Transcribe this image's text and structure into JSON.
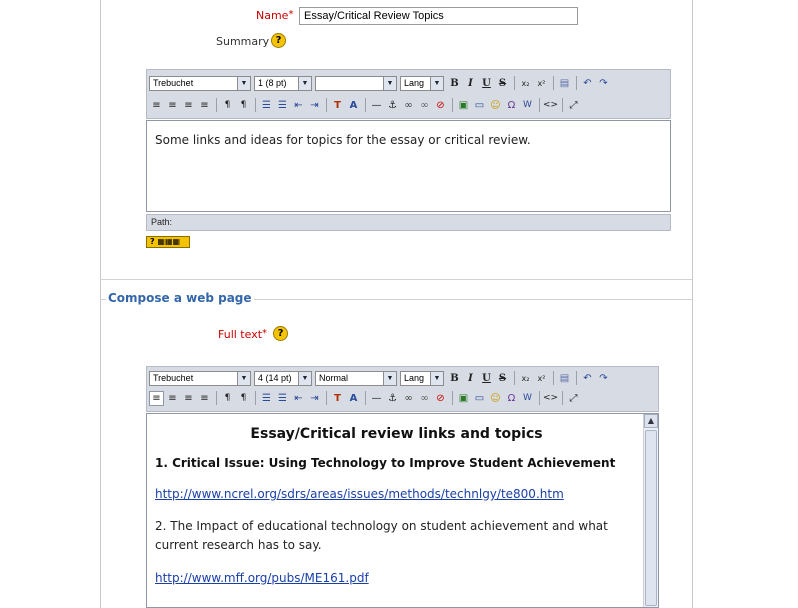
{
  "general": {
    "name_label": "Name",
    "name_required_star": "*",
    "name_value": "Essay/Critical Review Topics",
    "summary_label": "Summary",
    "help_icon_text": "?"
  },
  "summary_editor": {
    "font": "Trebuchet",
    "size": "1 (8 pt)",
    "style": "",
    "lang": "Lang",
    "content_text": "Some links and ideas for topics for the essay or critical review.",
    "path_label": "Path:"
  },
  "compose_section": {
    "legend": "Compose a web page",
    "full_text_label": "Full text",
    "full_text_required_star": "*"
  },
  "fulltext_editor": {
    "font": "Trebuchet",
    "size": "4 (14 pt)",
    "style": "Normal",
    "lang": "Lang",
    "heading": "Essay/Critical review links and topics",
    "item1": "1. Critical Issue: Using Technology to Improve Student Achievement",
    "link1": "http://www.ncrel.org/sdrs/areas/issues/methods/technlgy/te800.htm",
    "item2": "2. The Impact of educational technology on student achievement and what current research has to say.",
    "link2": "http://www.mff.org/pubs/ME161.pdf"
  },
  "toolbar_icons": {
    "bold": "B",
    "italic": "I",
    "underline": "U",
    "strike": "S",
    "subscript": "x₂",
    "superscript": "x²",
    "undo": "↶",
    "redo": "↷",
    "align_left": "≡",
    "align_center": "≡",
    "align_right": "≡",
    "justify": "≡",
    "ltr": "¶",
    "rtl": "¶",
    "ordered_list": "☰",
    "unordered_list": "☰",
    "outdent": "⇤",
    "indent": "⇥",
    "text_color": "T",
    "bg_color": "A",
    "hr": "—",
    "anchor": "⚓",
    "link": "∞",
    "unlink": "∞",
    "nolink": "⊘",
    "image": "▣",
    "table": "▭",
    "smiley": "☺",
    "special_char": "Ω",
    "paste_word": "W",
    "html_source": "<>",
    "fullscreen": "⤢"
  },
  "colors": {
    "required": "#cc0000",
    "legend": "#3366aa",
    "link": "#1a3fa8",
    "toolbar_bg": "#d7dbe3",
    "help_icon": "#f5c400"
  }
}
